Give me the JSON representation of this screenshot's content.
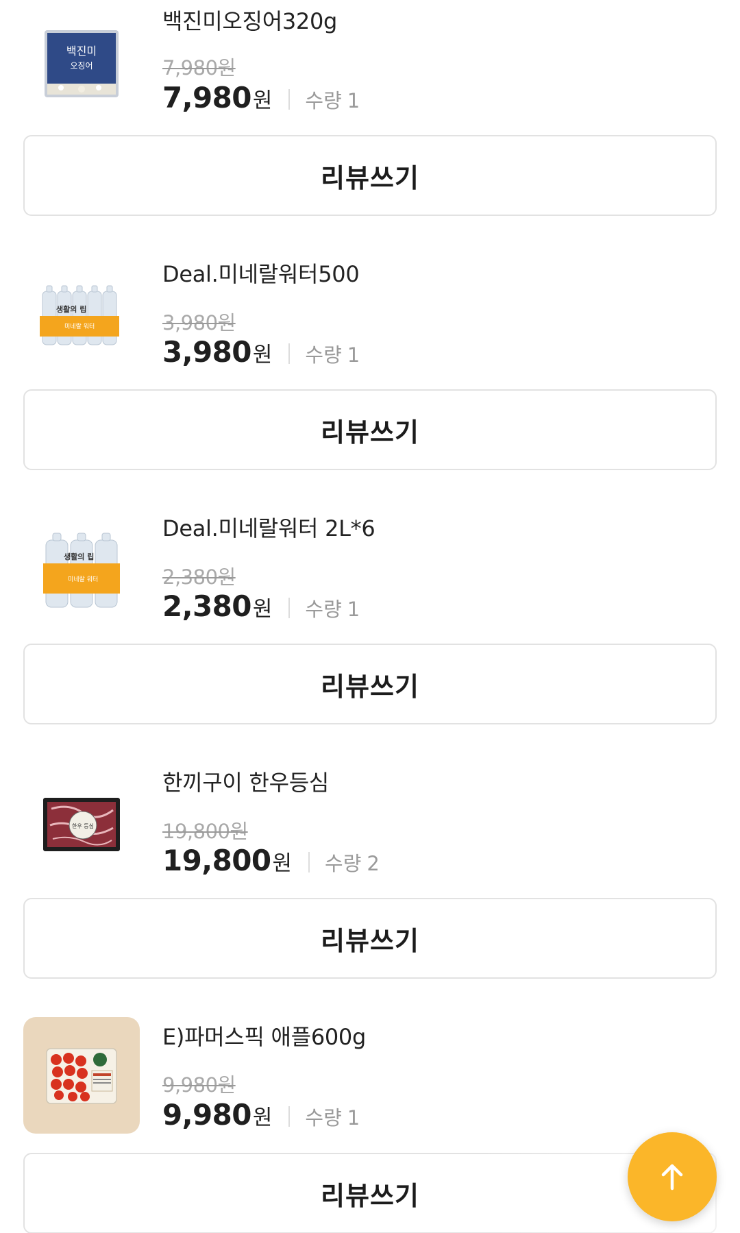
{
  "products": [
    {
      "name": "백진미오징어320g",
      "original_price": "7,980원",
      "price": "7,980",
      "currency": "원",
      "qty_label": "수량",
      "qty": "1",
      "review_label": "리뷰쓰기",
      "thumb_text": "백진미\n오징어"
    },
    {
      "name": "Deal.미네랄워터500",
      "original_price": "3,980원",
      "price": "3,980",
      "currency": "원",
      "qty_label": "수량",
      "qty": "1",
      "review_label": "리뷰쓰기",
      "thumb_text": "생활의 립"
    },
    {
      "name": "Deal.미네랄워터 2L*6",
      "original_price": "2,380원",
      "price": "2,380",
      "currency": "원",
      "qty_label": "수량",
      "qty": "1",
      "review_label": "리뷰쓰기",
      "thumb_text": "생활의 립"
    },
    {
      "name": "한끼구이 한우등심",
      "original_price": "19,800원",
      "price": "19,800",
      "currency": "원",
      "qty_label": "수량",
      "qty": "2",
      "review_label": "리뷰쓰기",
      "thumb_text": "한우 등심"
    },
    {
      "name": "E)파머스픽 애플600g",
      "original_price": "9,980원",
      "price": "9,980",
      "currency": "원",
      "qty_label": "수량",
      "qty": "1",
      "review_label": "리뷰쓰기",
      "thumb_text": ""
    }
  ],
  "scroll_top_button": {
    "icon": "arrow-up-icon"
  },
  "colors": {
    "accent": "#fbb629",
    "strike_text": "#a9a9a9",
    "border": "#e2e2e2",
    "label_bg_yellow": "#f4a51d"
  }
}
